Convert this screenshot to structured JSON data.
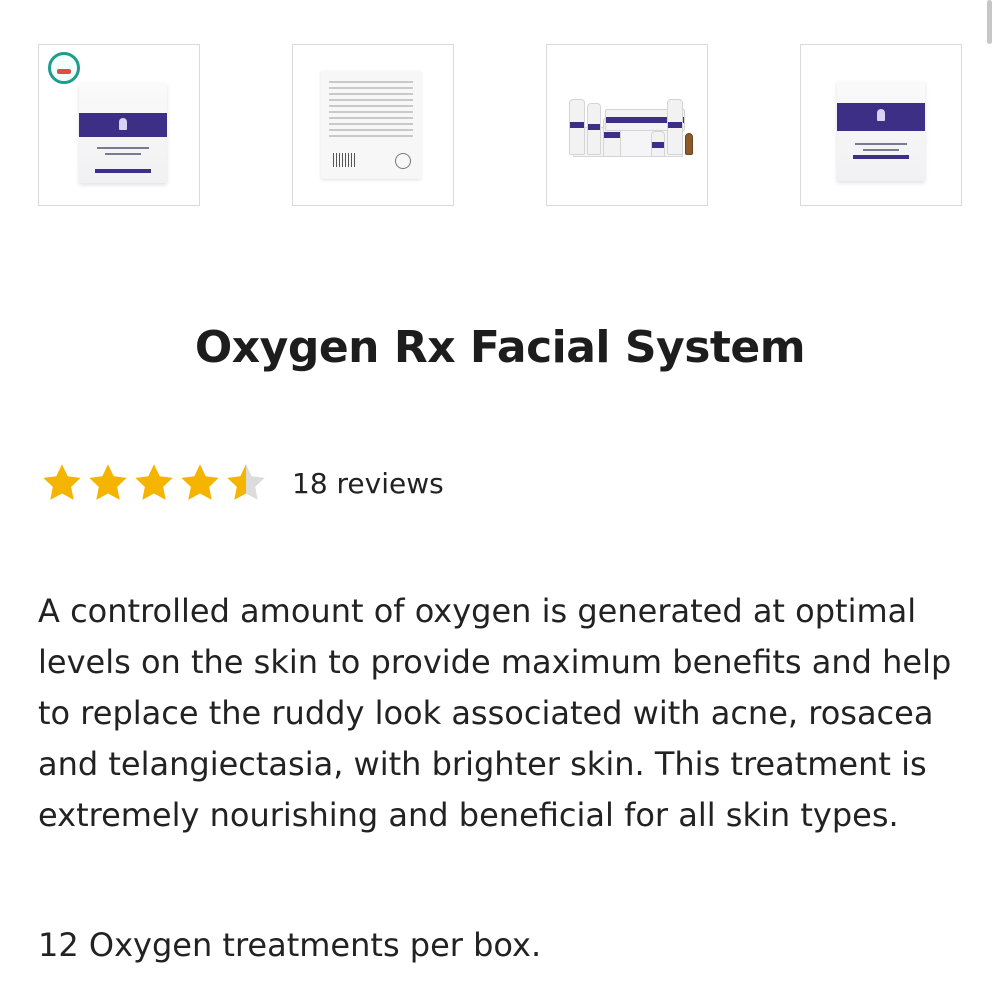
{
  "gallery": {
    "thumbnails": [
      {
        "alt": "Oxygen Rx Facial Mask box with badge"
      },
      {
        "alt": "Box back side"
      },
      {
        "alt": "Oxygen Rx Facial System kit"
      },
      {
        "alt": "Oxygen Rx Facial Mask box"
      }
    ]
  },
  "product": {
    "title": "Oxygen Rx Facial System",
    "rating": {
      "stars": 4.5,
      "max": 5,
      "reviews_label": "18 reviews",
      "star_color": "#f5b400",
      "empty_star_color": "#dcdcdc"
    },
    "description": "A controlled amount of oxygen is generated at optimal levels on the skin to provide maximum benefits and help to replace the ruddy look associated with acne, rosacea and telangiectasia, with brighter skin. This treatment is extremely nourishing and beneficial for all skin types.",
    "treatments": "12 Oxygen treatments per box."
  },
  "colors": {
    "accent": "#3d2f86",
    "text": "#1f1f1f"
  }
}
